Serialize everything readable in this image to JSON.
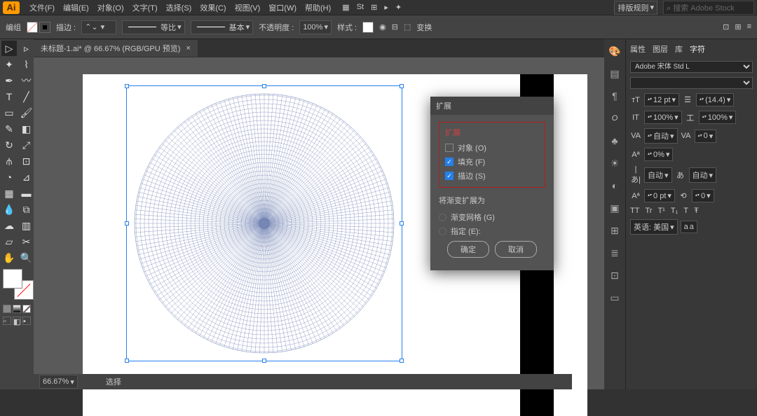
{
  "app_logo": "Ai",
  "menu": [
    "文件(F)",
    "编辑(E)",
    "对象(O)",
    "文字(T)",
    "选择(S)",
    "效果(C)",
    "视图(V)",
    "窗口(W)",
    "帮助(H)"
  ],
  "menu_right": {
    "essentials": "排版规则",
    "search_ph": "搜索 Adobe Stock"
  },
  "options": {
    "label": "编组",
    "stroke_label": "描边 :",
    "stroke_weight": "",
    "uniform": "等比",
    "basic": "基本",
    "opacity_label": "不透明度 :",
    "opacity": "100%",
    "style_label": "样式 :",
    "transform": "变换"
  },
  "doc": {
    "tab": "未标题-1.ai* @ 66.67% (RGB/GPU 预览)",
    "close": "×",
    "zoom": "66.67%",
    "status": "选择"
  },
  "dialog": {
    "title": "扩展",
    "group": "扩展",
    "obj": "对象 (O)",
    "fill": "填充 (F)",
    "stroke": "描边 (S)",
    "grad_label": "将渐变扩展为",
    "grad_mesh": "渐变网格 (G)",
    "grad_spec": "指定 (E):",
    "ok": "确定",
    "cancel": "取消"
  },
  "char": {
    "tabs": [
      "属性",
      "图层",
      "库",
      "字符"
    ],
    "font": "Adobe 宋体 Std L",
    "style": "",
    "size": "12 pt",
    "leading": "(14.4)",
    "hscale": "100%",
    "vscale": "100%",
    "kern": "自动",
    "track": "0",
    "baseline": "0%",
    "auto": "自动",
    "rot": "0 pt",
    "lang": "英语: 美国",
    "aa": "a"
  },
  "typo": {
    "row": [
      "TT",
      "Tr",
      "T¹",
      "T₁",
      "T",
      "Ŧ"
    ]
  }
}
